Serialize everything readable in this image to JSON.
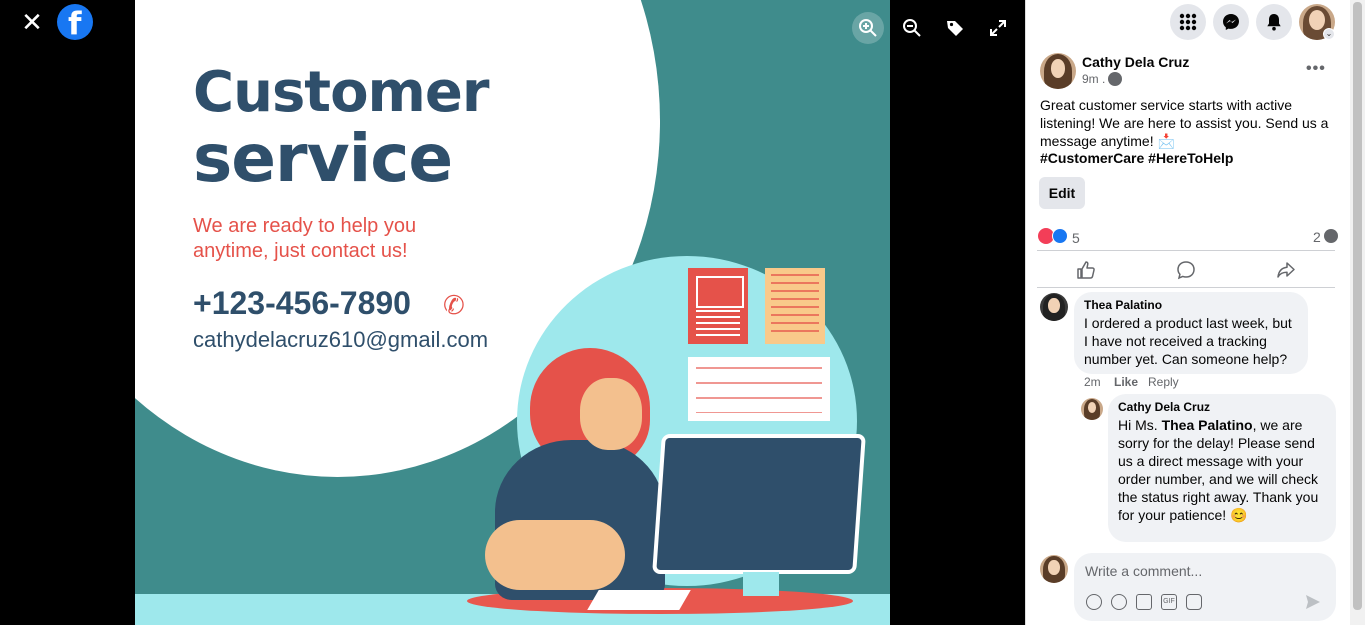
{
  "viewer": {
    "close_icon": "close-icon",
    "logo_icon": "facebook-logo",
    "logo_letter": "f"
  },
  "photo": {
    "title_line1": "Customer",
    "title_line2": "service",
    "tagline_line1": "We are ready to help you",
    "tagline_line2": "anytime, just contact us!",
    "phone": "+123-456-7890",
    "email": "cathydelacruz610@gmail.com",
    "colors": {
      "teal": "#3f8c8c",
      "navy": "#2f4f6b",
      "red": "#e5524a",
      "aqua": "#9ee8ec"
    }
  },
  "photo_toolbar": [
    "zoom-in-icon",
    "zoom-out-icon",
    "tag-icon",
    "fullscreen-icon"
  ],
  "top_nav": [
    "menu-grid-icon",
    "messenger-icon",
    "notifications-icon",
    "account-avatar"
  ],
  "post": {
    "author": "Cathy Dela Cruz",
    "time": "9m .",
    "text": "Great customer service starts with active listening! We are here to assist you. Send us a message anytime! 📩",
    "hashtags": "#CustomerCare #HereToHelp",
    "edit_label": "Edit",
    "reaction_count": "5",
    "comment_count": "2"
  },
  "comments": [
    {
      "author": "Thea Palatino",
      "text": "I ordered a product last week, but I have not received a tracking number yet. Can someone help?",
      "time": "2m",
      "like_label": "Like",
      "reply_label": "Reply"
    },
    {
      "author": "Cathy Dela Cruz",
      "text_prefix": "Hi Ms. ",
      "mention": "Thea Palatino",
      "text_rest": ", we are sorry for the delay! Please send us a direct message with your order number, and we will check the status right away. Thank you for your patience! 😊"
    }
  ],
  "comment_box": {
    "placeholder": "Write a comment..."
  },
  "colors": {
    "accent": "#1877f2",
    "love": "#f33e58",
    "bubble_bg": "#f0f2f5"
  }
}
